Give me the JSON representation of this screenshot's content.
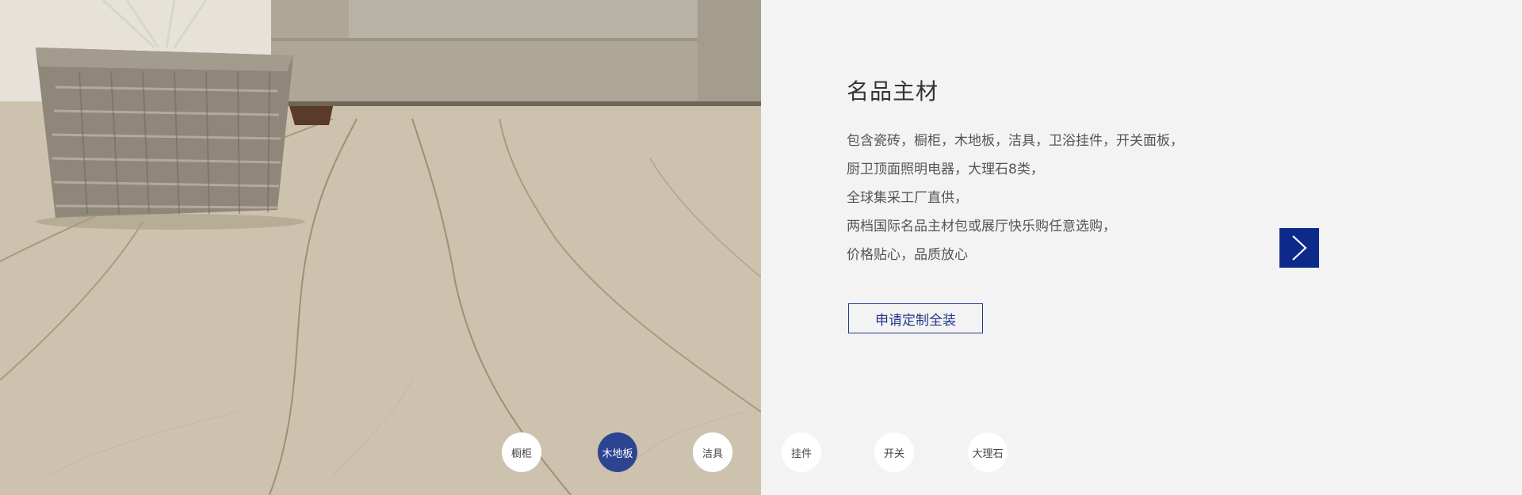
{
  "section": {
    "title": "名品主材",
    "description": [
      "包含瓷砖，橱柜，木地板，洁具，卫浴挂件，开关面板，",
      "厨卫顶面照明电器，大理石8类，",
      "全球集采工厂直供，",
      "两档国际名品主材包或展厅快乐购任意选购，",
      "价格贴心，品质放心"
    ],
    "cta_label": "申请定制全装"
  },
  "tabs": [
    {
      "label": "橱柜",
      "active": false
    },
    {
      "label": "木地板",
      "active": true
    },
    {
      "label": "洁具",
      "active": false
    },
    {
      "label": "挂件",
      "active": false
    },
    {
      "label": "开关",
      "active": false
    },
    {
      "label": "大理石",
      "active": false
    }
  ],
  "colors": {
    "accent": "#23378a",
    "active_tab": "#2d4591",
    "next_button": "#0d2a8a",
    "panel_bg": "#f3f3f3"
  },
  "icons": {
    "next": "chevron-right-icon"
  }
}
